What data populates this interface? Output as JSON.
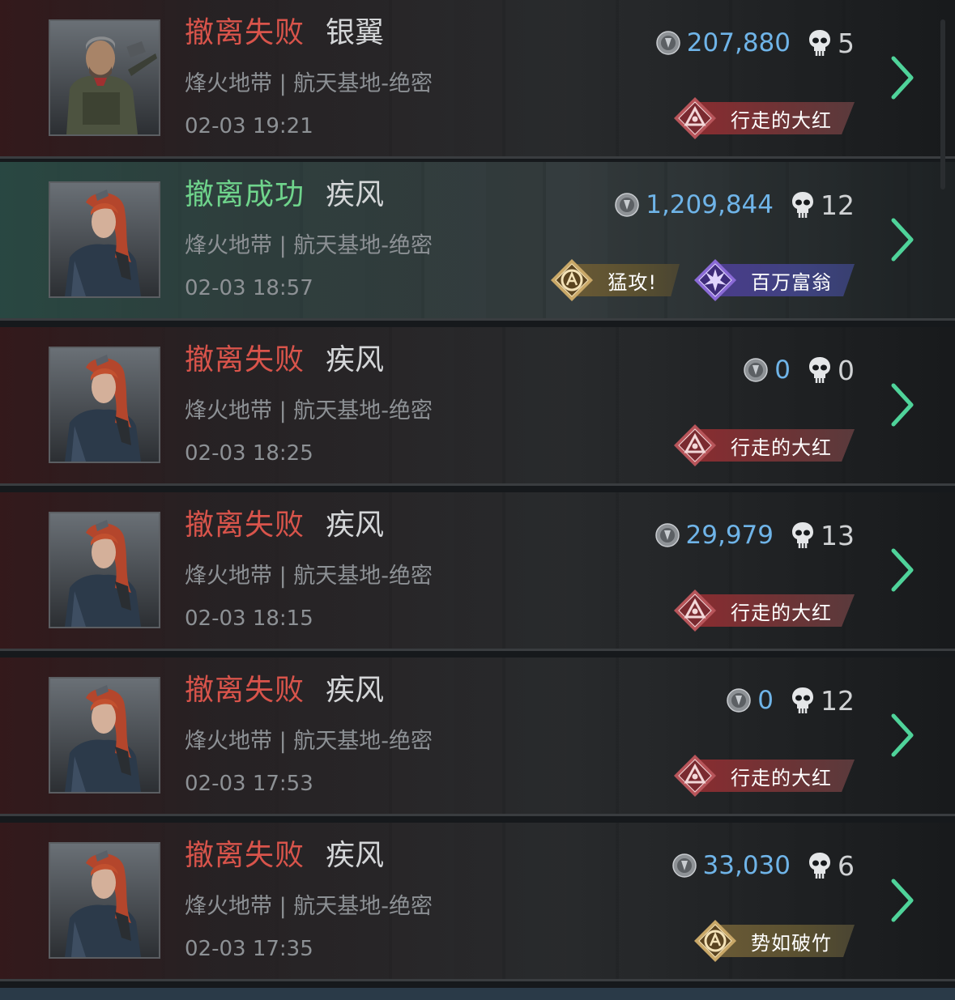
{
  "colors": {
    "fail": "#d9544b",
    "success": "#6fd48c",
    "coin_value": "#6fb4e8",
    "chevron": "#4fd39a"
  },
  "records": [
    {
      "status": "撤离失败",
      "result": "fail",
      "operator": "银翼",
      "map": "烽火地带 | 航天基地-绝密",
      "time": "02-03 19:21",
      "value": "207,880",
      "kills": "5",
      "badges": [
        {
          "label": "行走的大红",
          "style": "red",
          "icon": "triangle-emblem-icon"
        }
      ],
      "avatar": "operator-male-avatar"
    },
    {
      "status": "撤离成功",
      "result": "success",
      "operator": "疾风",
      "map": "烽火地带 | 航天基地-绝密",
      "time": "02-03 18:57",
      "value": "1,209,844",
      "kills": "12",
      "badges": [
        {
          "label": "猛攻!",
          "style": "gold",
          "icon": "charge-emblem-icon"
        },
        {
          "label": "百万富翁",
          "style": "purple",
          "icon": "burst-emblem-icon"
        }
      ],
      "avatar": "operator-female-avatar"
    },
    {
      "status": "撤离失败",
      "result": "fail",
      "operator": "疾风",
      "map": "烽火地带 | 航天基地-绝密",
      "time": "02-03 18:25",
      "value": "0",
      "kills": "0",
      "badges": [
        {
          "label": "行走的大红",
          "style": "red",
          "icon": "triangle-emblem-icon"
        }
      ],
      "avatar": "operator-female-avatar"
    },
    {
      "status": "撤离失败",
      "result": "fail",
      "operator": "疾风",
      "map": "烽火地带 | 航天基地-绝密",
      "time": "02-03 18:15",
      "value": "29,979",
      "kills": "13",
      "badges": [
        {
          "label": "行走的大红",
          "style": "red",
          "icon": "triangle-emblem-icon"
        }
      ],
      "avatar": "operator-female-avatar"
    },
    {
      "status": "撤离失败",
      "result": "fail",
      "operator": "疾风",
      "map": "烽火地带 | 航天基地-绝密",
      "time": "02-03 17:53",
      "value": "0",
      "kills": "12",
      "badges": [
        {
          "label": "行走的大红",
          "style": "red",
          "icon": "triangle-emblem-icon"
        }
      ],
      "avatar": "operator-female-avatar"
    },
    {
      "status": "撤离失败",
      "result": "fail",
      "operator": "疾风",
      "map": "烽火地带 | 航天基地-绝密",
      "time": "02-03 17:35",
      "value": "33,030",
      "kills": "6",
      "badges": [
        {
          "label": "势如破竹",
          "style": "gold",
          "icon": "charge-emblem-icon"
        }
      ],
      "avatar": "operator-female-avatar"
    }
  ]
}
